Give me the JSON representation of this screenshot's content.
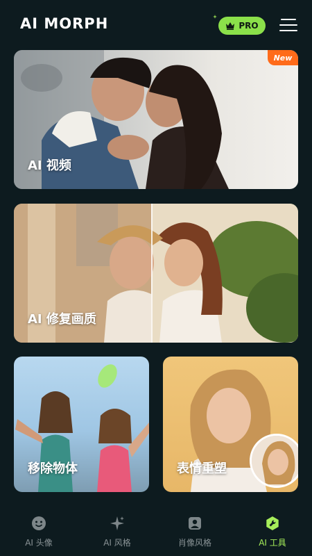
{
  "header": {
    "logo": "AI MORPH",
    "pro_label": "PRO"
  },
  "cards": {
    "video": {
      "label": "AI 视频",
      "badge": "New"
    },
    "restore": {
      "label": "AI 修复画质"
    },
    "remove": {
      "label": "移除物体"
    },
    "expression": {
      "label": "表情重塑"
    }
  },
  "nav": {
    "items": [
      {
        "label": "AI 头像",
        "icon": "smiley-face-icon"
      },
      {
        "label": "AI 风格",
        "icon": "sparkle-icon"
      },
      {
        "label": "肖像风格",
        "icon": "portrait-icon"
      },
      {
        "label": "AI 工具",
        "icon": "wrench-icon",
        "active": true
      }
    ]
  },
  "colors": {
    "background": "#0d1b1f",
    "accent": "#8be04a",
    "badge": "#ff6b1a",
    "nav_active": "#a6ee5a",
    "nav_inactive": "#8a9396"
  }
}
